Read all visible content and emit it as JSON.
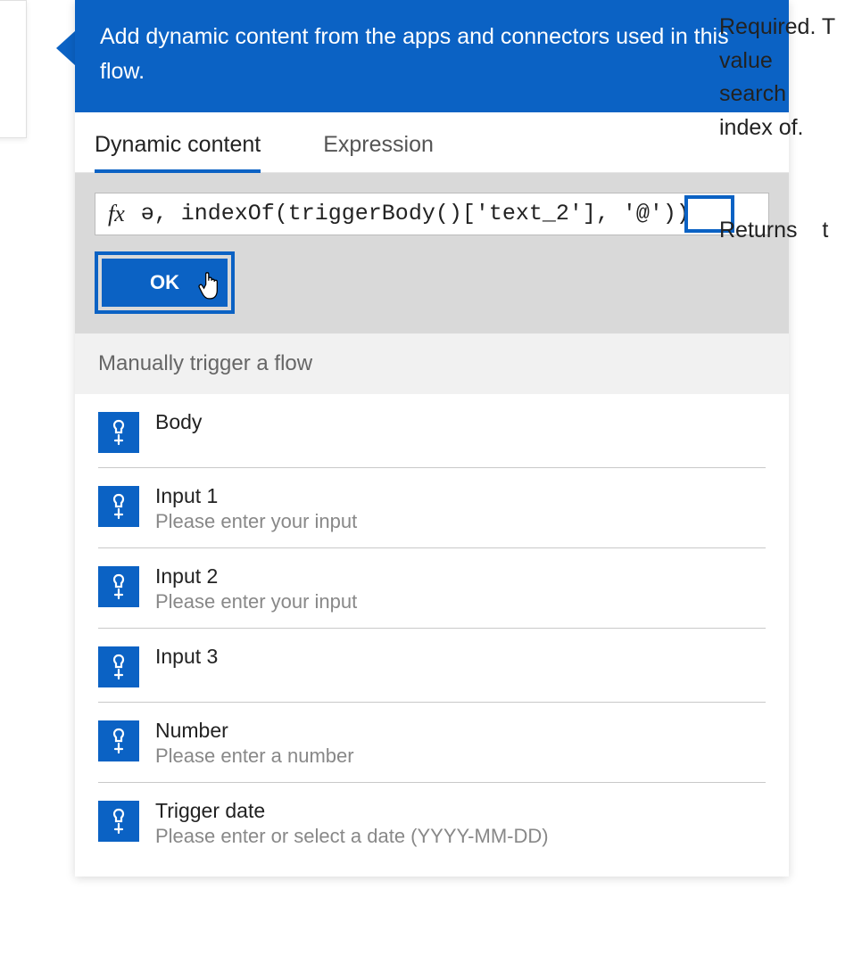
{
  "banner": {
    "text": "Add dynamic content from the apps and connectors used in this flow."
  },
  "tabs": {
    "dynamic": "Dynamic content",
    "expression": "Expression"
  },
  "expression": {
    "fx": "fx",
    "value": "ə, indexOf(triggerBody()['text_2'], '@'))",
    "ok": "OK"
  },
  "section": {
    "title": "Manually trigger a flow"
  },
  "items": [
    {
      "title": "Body",
      "sub": ""
    },
    {
      "title": "Input 1",
      "sub": "Please enter your input"
    },
    {
      "title": "Input 2",
      "sub": "Please enter your input"
    },
    {
      "title": "Input 3",
      "sub": ""
    },
    {
      "title": "Number",
      "sub": "Please enter a number"
    },
    {
      "title": "Trigger date",
      "sub": "Please enter or select a date (YYYY-MM-DD)"
    }
  ],
  "tooltip": {
    "line1": "Required.  T",
    "line2": "value",
    "line3": "search             t",
    "line4": "index of.",
    "returns": "Returns    t"
  }
}
